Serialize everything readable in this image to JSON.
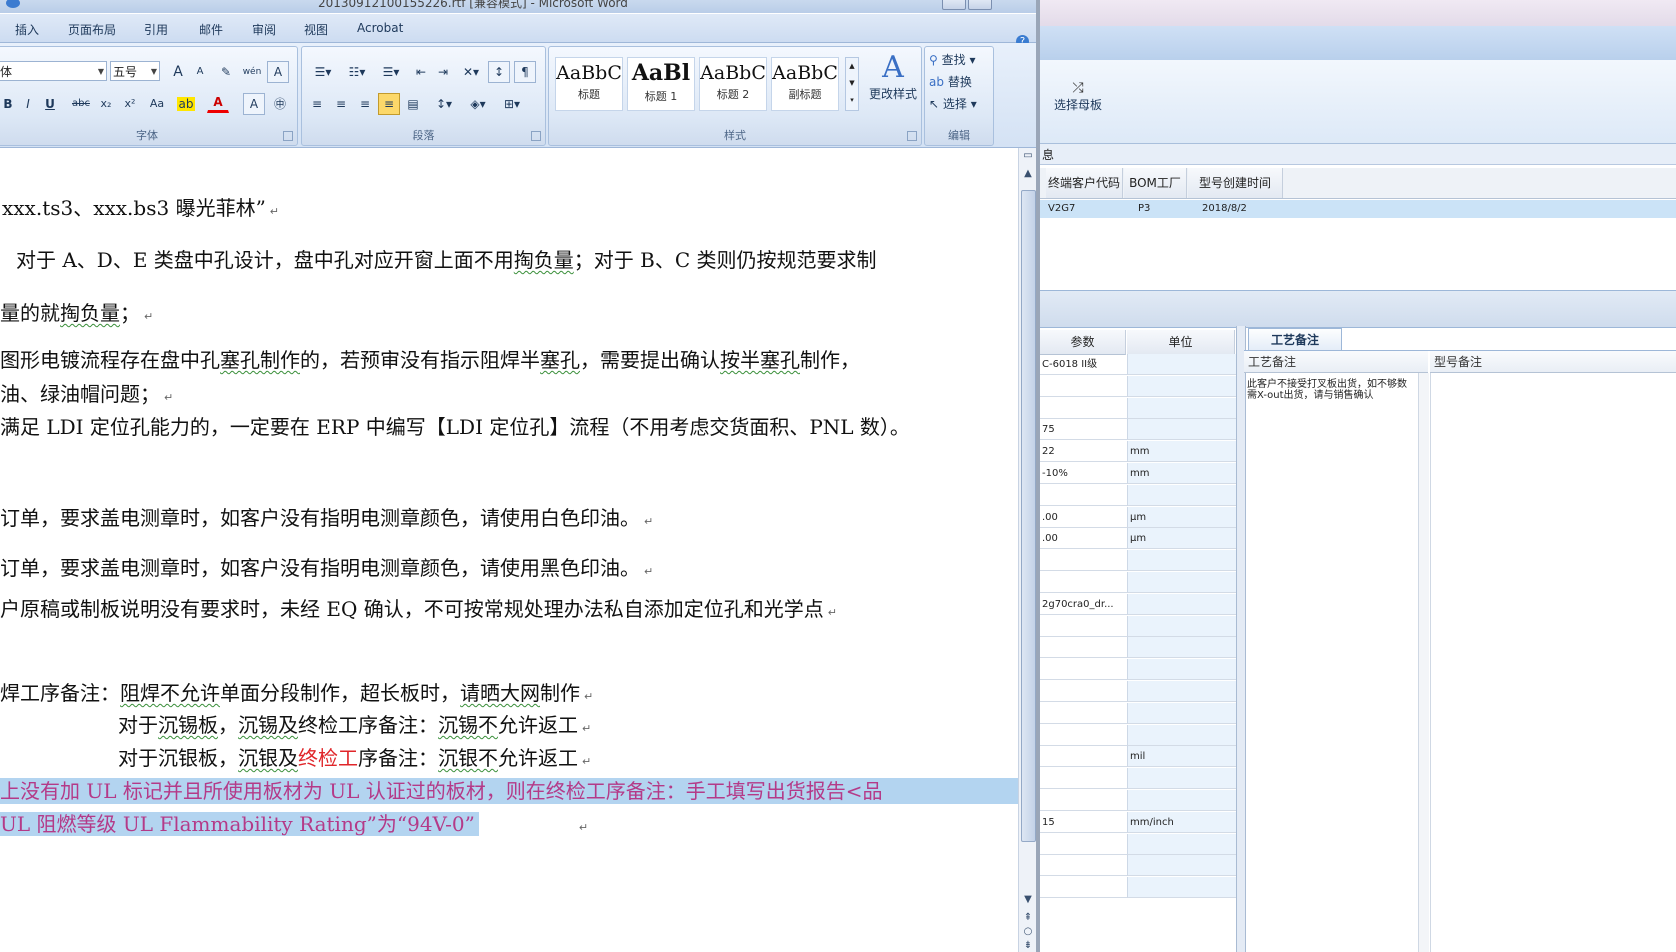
{
  "word": {
    "title": "20130912100155226.rtf [兼容模式] - Microsoft Word",
    "ribbon_tabs": [
      "插入",
      "页面布局",
      "引用",
      "邮件",
      "审阅",
      "视图",
      "Acrobat"
    ],
    "help": "?",
    "font_group": {
      "label": "字体",
      "font_name": "体",
      "font_size": "五号",
      "grow": "A",
      "shrink": "A",
      "bold": "B",
      "italic": "I",
      "underline": "U",
      "strike": "abc",
      "subscript": "x₂",
      "superscript": "x²",
      "change_case": "Aa",
      "font_color": "A"
    },
    "paragraph_group": {
      "label": "段落"
    },
    "styles_group": {
      "label": "样式",
      "tiles": [
        {
          "sample": "AaBbC",
          "name": "标题"
        },
        {
          "sample": "AaBl",
          "name": "标题 1"
        },
        {
          "sample": "AaBbC",
          "name": "标题 2"
        },
        {
          "sample": "AaBbC",
          "name": "副标题"
        }
      ],
      "change_styles": "更改样式"
    },
    "editing_group": {
      "label": "编辑",
      "find": "查找",
      "replace": "替换",
      "select": "选择"
    },
    "document": {
      "line1": "xxx.ts3、xxx.bs3 曝光菲林”",
      "line2a": "对于 A、D、E 类盘中孔设计，盘中孔对应开窗上面不用",
      "line2b": "掏负量",
      "line2c": "；对于 B、C 类则仍按规范要求制",
      "line3a": "量的就",
      "line3b": "掏负量",
      "line3c": "；",
      "line4a": "图形电镀流程存在盘中孔",
      "line4b": "塞孔制作",
      "line4c": "的，若预审没有指示阻焊半",
      "line4d": "塞孔",
      "line4e": "，需要提出确认",
      "line4f": "按半塞孔",
      "line4g": "制作，",
      "line5": "油、绿油帽问题；",
      "line6": "满足 LDI 定位孔能力的，一定要在 ERP 中编写【LDI 定位孔】流程（不用考虑交货面积、PNL 数）。",
      "line7": "订单，要求盖电测章时，如客户没有指明电测章颜色，请使用白色印油。",
      "line8": "订单，要求盖电测章时，如客户没有指明电测章颜色，请使用黑色印油。",
      "line9": "户原稿或制板说明没有要求时，未经 EQ 确认，不可按常规处理办法私自添加定位孔和光学点",
      "line10a": "焊工序备注：",
      "line10b": "阻焊不允许",
      "line10c": "单面分段制作，超长板时，",
      "line10d": "请晒大网",
      "line10e": "制作",
      "line11a": "对于",
      "line11b": "沉锡板",
      "line11c": "，",
      "line11d": "沉锡及",
      "line11e": "终检工序备注：",
      "line11f": "沉锡不",
      "line11g": "允许返工",
      "line12a": "对于沉银板，",
      "line12b": "沉银及",
      "line12c": "终检工",
      "line12d": "序备注：",
      "line12e": "沉银不",
      "line12f": "允许返工",
      "line13": "上没有加 UL 标记并且所使用板材为 UL 认证过的板材，则在终检工序备注：手工填写出货报告<品",
      "line14": "UL 阻燃等级 UL Flammability Rating”为“94V-0”"
    }
  },
  "erp": {
    "select_mother": "选择母板",
    "info_tab": "息",
    "grid_headers": [
      "终端客户代码",
      "BOM工厂",
      "型号创建时间"
    ],
    "grid_row": [
      "V2G7",
      "P3",
      "2018/8/2"
    ],
    "param_headers": {
      "param": "参数",
      "unit": "单位"
    },
    "params": [
      {
        "param": "C-6018 II级",
        "unit": ""
      },
      {
        "param": "",
        "unit": ""
      },
      {
        "param": "",
        "unit": ""
      },
      {
        "param": "75",
        "unit": ""
      },
      {
        "param": "22",
        "unit": "mm"
      },
      {
        "param": "-10%",
        "unit": "mm"
      },
      {
        "param": "",
        "unit": ""
      },
      {
        "param": ".00",
        "unit": "μm"
      },
      {
        "param": ".00",
        "unit": "μm"
      },
      {
        "param": "",
        "unit": ""
      },
      {
        "param": "",
        "unit": ""
      },
      {
        "param": "2g70cra0_dr...",
        "unit": ""
      },
      {
        "param": "",
        "unit": ""
      },
      {
        "param": "",
        "unit": ""
      },
      {
        "param": "",
        "unit": ""
      },
      {
        "param": "",
        "unit": ""
      },
      {
        "param": "",
        "unit": ""
      },
      {
        "param": "",
        "unit": ""
      },
      {
        "param": "",
        "unit": "mil"
      },
      {
        "param": "",
        "unit": ""
      },
      {
        "param": "",
        "unit": ""
      },
      {
        "param": "15",
        "unit": "mm/inch"
      },
      {
        "param": "",
        "unit": ""
      },
      {
        "param": "",
        "unit": ""
      },
      {
        "param": "",
        "unit": ""
      }
    ],
    "remark_tab": "工艺备注",
    "remark_headers": {
      "process": "工艺备注",
      "model": "型号备注"
    },
    "remark_text": "此客户不接受打叉板出货，如不够数需X-out出货，请与销售确认"
  }
}
